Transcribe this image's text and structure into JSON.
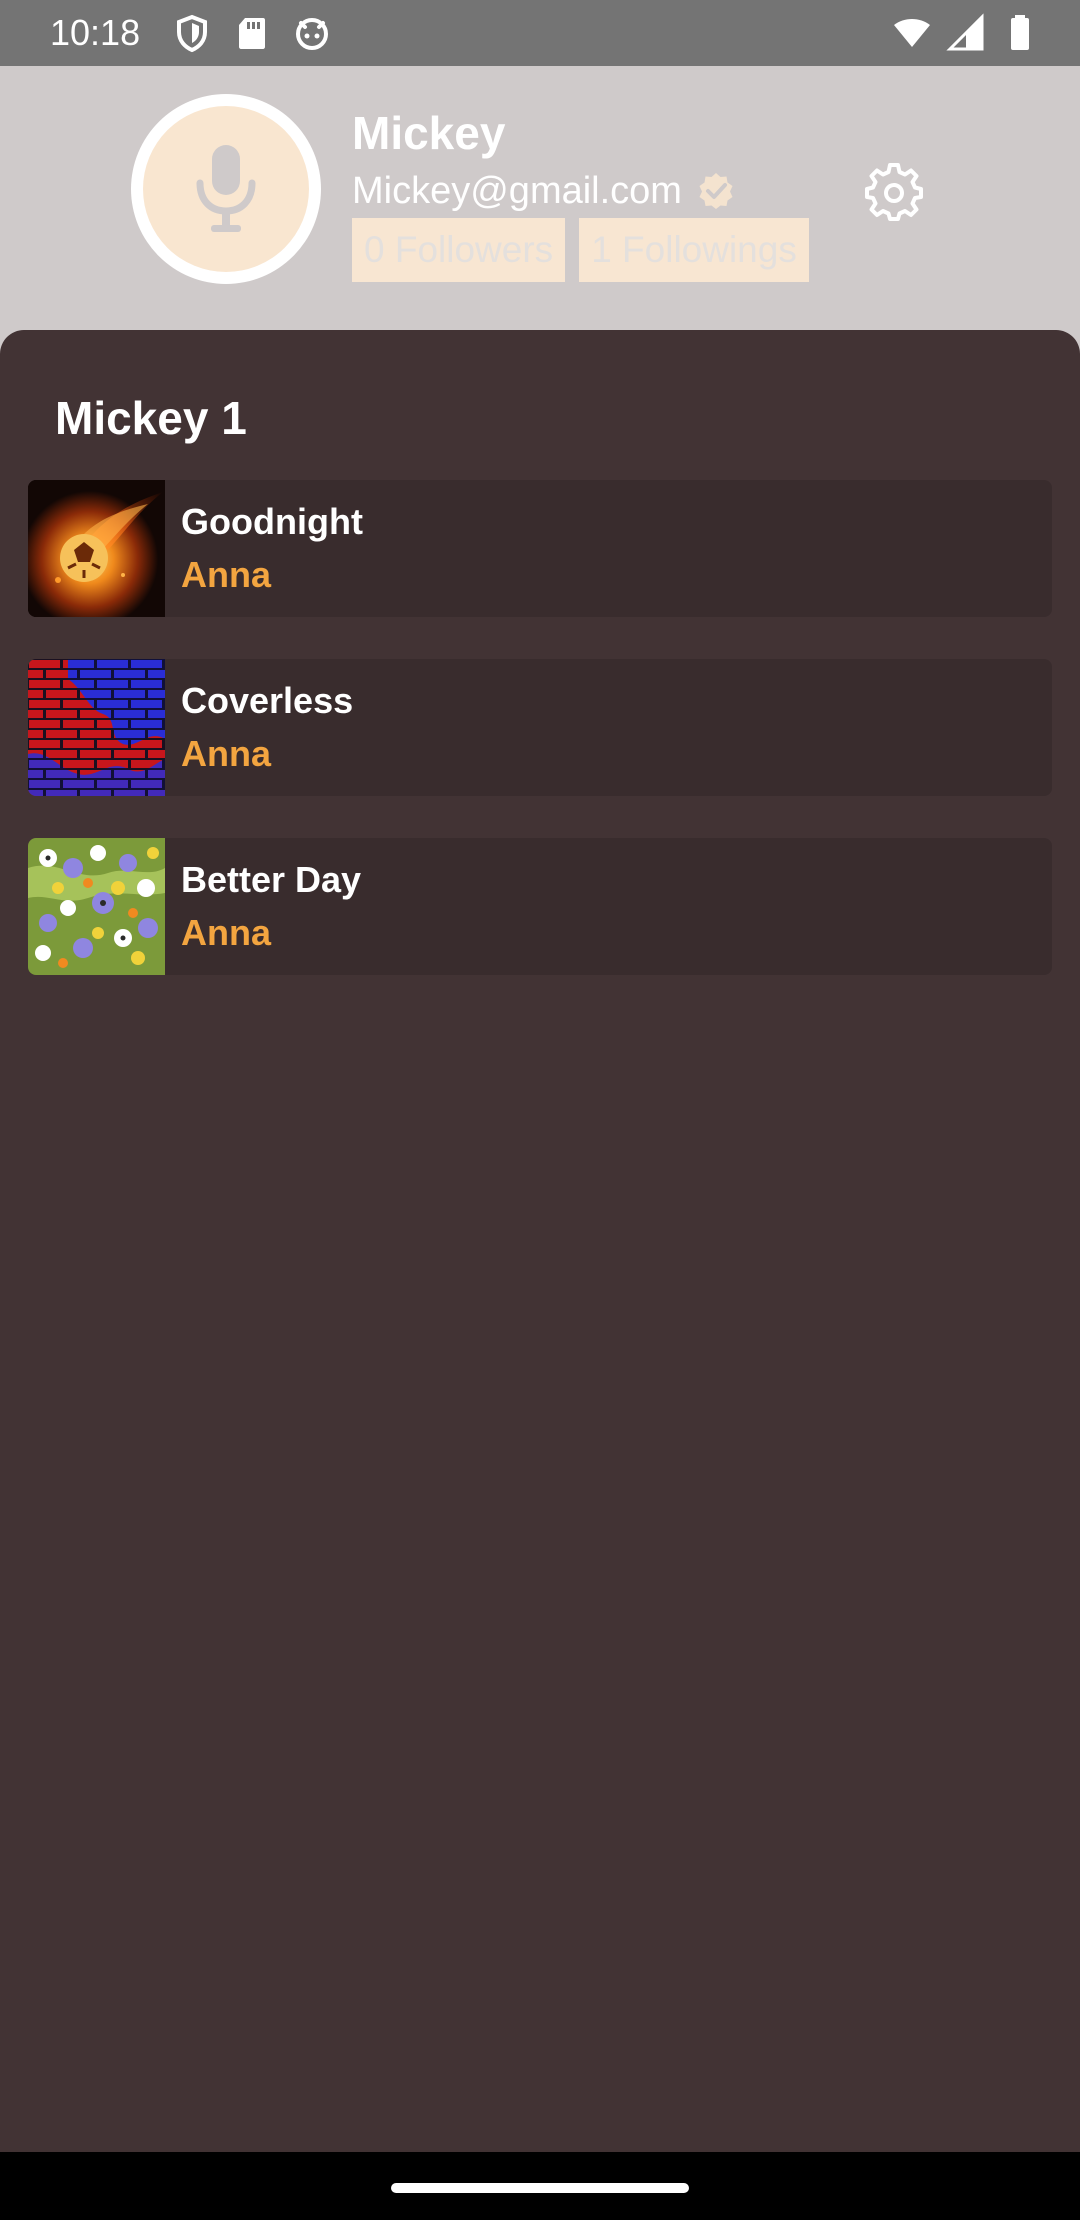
{
  "status_bar": {
    "time": "10:18",
    "left_icons": [
      "shield-icon",
      "sd-card-icon",
      "android-face-icon"
    ],
    "right_icons": [
      "wifi-icon",
      "cellular-signal-icon",
      "battery-icon"
    ]
  },
  "profile": {
    "name": "Mickey",
    "email": "Mickey@gmail.com",
    "verified_icon": "verified-badge-icon",
    "followers_label": "0 Followers",
    "followings_label": "1 Followings",
    "avatar_icon": "microphone-icon",
    "settings_icon": "gear-icon"
  },
  "playlist": {
    "title": "Mickey 1",
    "tracks": [
      {
        "title": "Goodnight",
        "artist": "Anna",
        "thumb": "flaming-soccer-ball"
      },
      {
        "title": "Coverless",
        "artist": "Anna",
        "thumb": "red-blue-brick-wall"
      },
      {
        "title": "Better Day",
        "artist": "Anna",
        "thumb": "wildflowers"
      }
    ]
  },
  "colors": {
    "header_bg": "#cfcaca",
    "panel_bg": "#423334",
    "row_bg": "#392c2d",
    "accent": "#f3a540",
    "pill_bg": "#f8e6d2"
  }
}
